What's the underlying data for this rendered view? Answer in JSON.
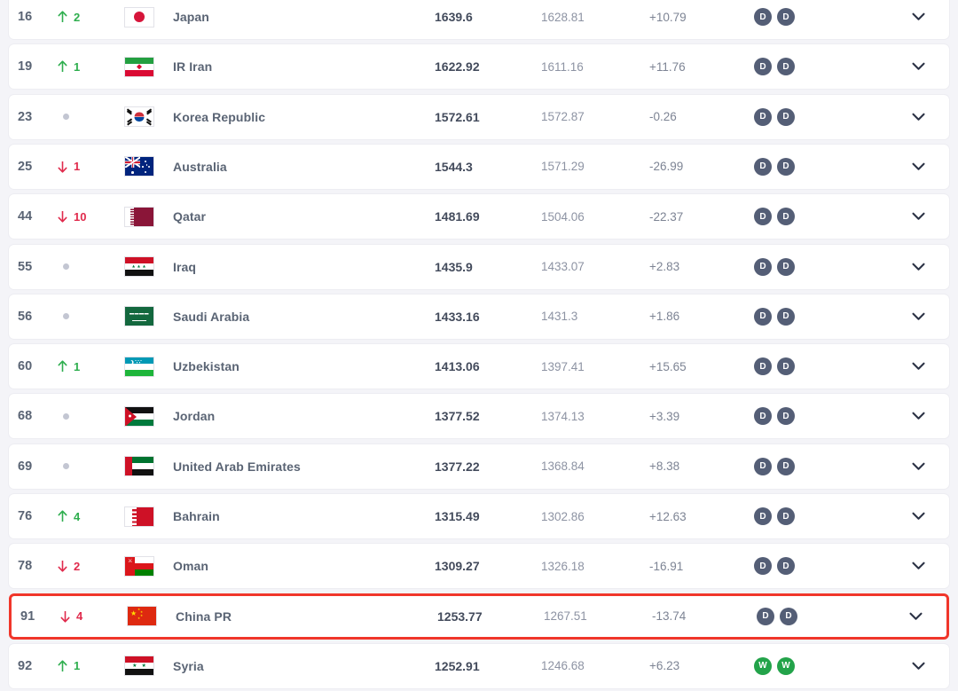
{
  "table": {
    "type": "fifa-world-ranking",
    "columns": [
      "rank",
      "movement",
      "flag",
      "team",
      "points",
      "previous_points",
      "delta",
      "recent_results",
      "expand"
    ],
    "highlight_color": "#f0362a",
    "colors": {
      "up": "#2eae4e",
      "down": "#e02a4c",
      "nochange": "#c3c6d2",
      "badge_draw": "#545e76",
      "badge_win": "#23a34a",
      "row_background": "#ffffff",
      "page_background": "#f4f4f8"
    },
    "rows": [
      {
        "rank": "16",
        "move_dir": "up",
        "move_count": "2",
        "flag": "japan",
        "team": "Japan",
        "points": "1639.6",
        "previous": "1628.81",
        "delta": "+10.79",
        "badges": [
          "D",
          "D"
        ],
        "highlighted": false
      },
      {
        "rank": "19",
        "move_dir": "up",
        "move_count": "1",
        "flag": "iran",
        "team": "IR Iran",
        "points": "1622.92",
        "previous": "1611.16",
        "delta": "+11.76",
        "badges": [
          "D",
          "D"
        ],
        "highlighted": false
      },
      {
        "rank": "23",
        "move_dir": "none",
        "move_count": "",
        "flag": "korea",
        "team": "Korea Republic",
        "points": "1572.61",
        "previous": "1572.87",
        "delta": "-0.26",
        "badges": [
          "D",
          "D"
        ],
        "highlighted": false
      },
      {
        "rank": "25",
        "move_dir": "down",
        "move_count": "1",
        "flag": "australia",
        "team": "Australia",
        "points": "1544.3",
        "previous": "1571.29",
        "delta": "-26.99",
        "badges": [
          "D",
          "D"
        ],
        "highlighted": false
      },
      {
        "rank": "44",
        "move_dir": "down",
        "move_count": "10",
        "flag": "qatar",
        "team": "Qatar",
        "points": "1481.69",
        "previous": "1504.06",
        "delta": "-22.37",
        "badges": [
          "D",
          "D"
        ],
        "highlighted": false
      },
      {
        "rank": "55",
        "move_dir": "none",
        "move_count": "",
        "flag": "iraq",
        "team": "Iraq",
        "points": "1435.9",
        "previous": "1433.07",
        "delta": "+2.83",
        "badges": [
          "D",
          "D"
        ],
        "highlighted": false
      },
      {
        "rank": "56",
        "move_dir": "none",
        "move_count": "",
        "flag": "ksa",
        "team": "Saudi Arabia",
        "points": "1433.16",
        "previous": "1431.3",
        "delta": "+1.86",
        "badges": [
          "D",
          "D"
        ],
        "highlighted": false
      },
      {
        "rank": "60",
        "move_dir": "up",
        "move_count": "1",
        "flag": "uzbekistan",
        "team": "Uzbekistan",
        "points": "1413.06",
        "previous": "1397.41",
        "delta": "+15.65",
        "badges": [
          "D",
          "D"
        ],
        "highlighted": false
      },
      {
        "rank": "68",
        "move_dir": "none",
        "move_count": "",
        "flag": "jordan",
        "team": "Jordan",
        "points": "1377.52",
        "previous": "1374.13",
        "delta": "+3.39",
        "badges": [
          "D",
          "D"
        ],
        "highlighted": false
      },
      {
        "rank": "69",
        "move_dir": "none",
        "move_count": "",
        "flag": "uae",
        "team": "United Arab Emirates",
        "points": "1377.22",
        "previous": "1368.84",
        "delta": "+8.38",
        "badges": [
          "D",
          "D"
        ],
        "highlighted": false
      },
      {
        "rank": "76",
        "move_dir": "up",
        "move_count": "4",
        "flag": "bahrain",
        "team": "Bahrain",
        "points": "1315.49",
        "previous": "1302.86",
        "delta": "+12.63",
        "badges": [
          "D",
          "D"
        ],
        "highlighted": false
      },
      {
        "rank": "78",
        "move_dir": "down",
        "move_count": "2",
        "flag": "oman",
        "team": "Oman",
        "points": "1309.27",
        "previous": "1326.18",
        "delta": "-16.91",
        "badges": [
          "D",
          "D"
        ],
        "highlighted": false
      },
      {
        "rank": "91",
        "move_dir": "down",
        "move_count": "4",
        "flag": "china",
        "team": "China PR",
        "points": "1253.77",
        "previous": "1267.51",
        "delta": "-13.74",
        "badges": [
          "D",
          "D"
        ],
        "highlighted": true
      },
      {
        "rank": "92",
        "move_dir": "up",
        "move_count": "1",
        "flag": "syria",
        "team": "Syria",
        "points": "1252.91",
        "previous": "1246.68",
        "delta": "+6.23",
        "badges": [
          "W",
          "W"
        ],
        "highlighted": false
      }
    ]
  },
  "icons": {
    "up_arrow": "arrow-up-icon",
    "down_arrow": "arrow-down-icon",
    "nochange": "dash-dot-icon",
    "expand": "chevron-down-icon"
  }
}
